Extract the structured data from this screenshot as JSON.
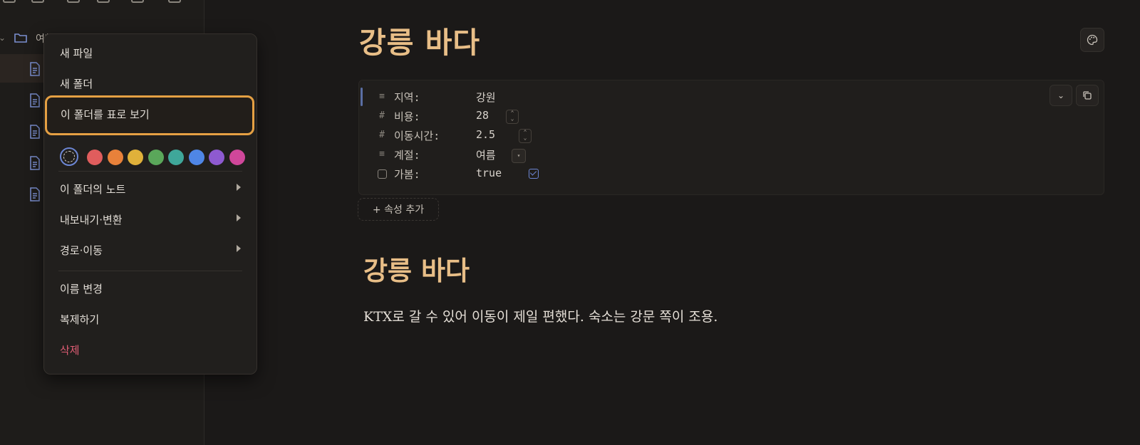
{
  "sidebar": {
    "folder_label": "여행 후보"
  },
  "note": {
    "title": "강릉 바다",
    "properties": [
      {
        "icon": "text-icon",
        "name": "지역:",
        "value": "강원"
      },
      {
        "icon": "number-icon",
        "name": "비용:",
        "value": "28"
      },
      {
        "icon": "number-icon",
        "name": "이동시간:",
        "value": "2.5"
      },
      {
        "icon": "text-icon",
        "name": "계절:",
        "value": "여름"
      },
      {
        "icon": "checkbox-icon",
        "name": "가봄:",
        "value": "true"
      }
    ],
    "add_property_label": "+ 속성 추가",
    "heading": "강릉 바다",
    "body": "KTX로 갈 수 있어 이동이 제일 편했다. 숙소는 강문 쪽이 조용."
  },
  "menu": {
    "new_file": "새 파일",
    "new_folder": "새 폴더",
    "view_as_table": "이 폴더를 표로 보기",
    "notes_in_folder": "이 폴더의 노트",
    "export_convert": "내보내기·변환",
    "path_move": "경로·이동",
    "rename": "이름 변경",
    "duplicate": "복제하기",
    "delete": "삭제",
    "colors": [
      "#e05d5d",
      "#e8813a",
      "#e0b13a",
      "#5aa75a",
      "#3fa79a",
      "#4f86e6",
      "#8e5ad0",
      "#d0479a"
    ]
  },
  "colors": {
    "accent_title": "#e8be87",
    "highlight_border": "#e5a043",
    "danger": "#e05d74"
  }
}
